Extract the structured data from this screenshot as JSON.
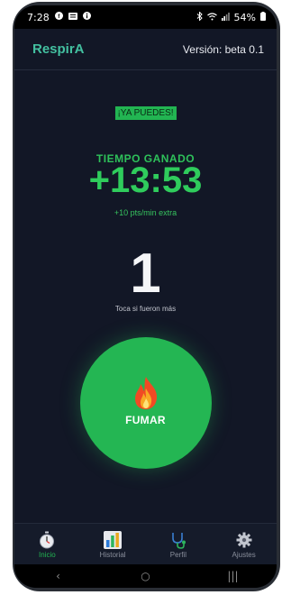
{
  "status_bar": {
    "time": "7:28",
    "battery": "54%",
    "right_icons": [
      "bluetooth-icon",
      "wifi-icon",
      "signal-icon",
      "battery-icon"
    ],
    "left_icons": [
      "facebook-icon",
      "news-icon",
      "info-icon"
    ]
  },
  "header": {
    "app_name": "RespirA",
    "version": "Versión: beta 0.1"
  },
  "main": {
    "status_badge": "¡YA PUEDES!",
    "gain_label": "TIEMPO GANADO",
    "gain_value": "+13:53",
    "gain_extra": "+10 pts/min extra",
    "count": "1",
    "count_hint": "Toca si fueron más",
    "smoke_button_label": "FUMAR"
  },
  "nav": {
    "items": [
      {
        "label": "Inicio",
        "icon": "stopwatch-icon",
        "active": true
      },
      {
        "label": "Historial",
        "icon": "bar-chart-icon",
        "active": false
      },
      {
        "label": "Perfil",
        "icon": "stethoscope-icon",
        "active": false
      },
      {
        "label": "Ajustes",
        "icon": "gear-icon",
        "active": false
      }
    ]
  },
  "system_nav": {
    "back": "‹",
    "home": "○",
    "recents": "|||"
  },
  "colors": {
    "background": "#121726",
    "accent_green": "#24b653",
    "logo_teal": "#43c0a0"
  }
}
